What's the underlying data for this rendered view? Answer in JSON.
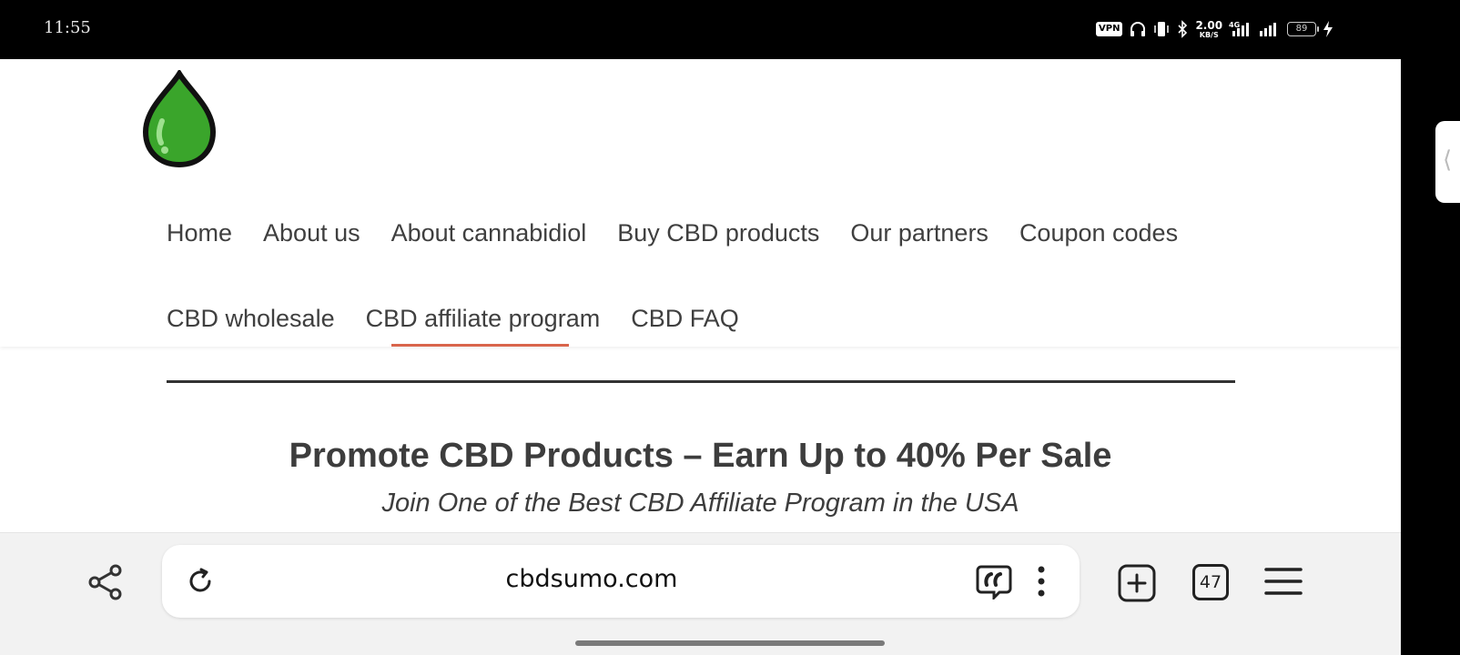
{
  "status_bar": {
    "time": "11:55",
    "vpn_label": "VPN",
    "net_speed_value": "2.00",
    "net_speed_unit": "KB/S",
    "network_type": "4G",
    "battery_level": "89",
    "icons": [
      "headphones-icon",
      "vibrate-icon",
      "bluetooth-icon",
      "signal-icon",
      "signal-icon",
      "battery-icon",
      "charging-icon"
    ]
  },
  "site": {
    "logo": "green-drop-logo",
    "nav_row1": [
      "Home",
      "About us",
      "About cannabidiol",
      "Buy CBD products",
      "Our partners",
      "Coupon codes"
    ],
    "nav_row2": [
      "CBD wholesale",
      "CBD affiliate program",
      "CBD FAQ"
    ],
    "active_nav": "CBD affiliate program",
    "accent_color": "#d9654b",
    "logo_color": "#3aa52b"
  },
  "hero": {
    "title": "Promote CBD Products – Earn Up to 40% Per Sale",
    "subtitle": "Join One of the Best CBD Affiliate Program in the USA"
  },
  "browser": {
    "url": "cbdsumo.com",
    "tab_count": "47",
    "icons": [
      "share-icon",
      "reload-icon",
      "quote-icon",
      "more-vertical-icon",
      "new-tab-icon",
      "tabs-icon",
      "menu-icon"
    ]
  }
}
